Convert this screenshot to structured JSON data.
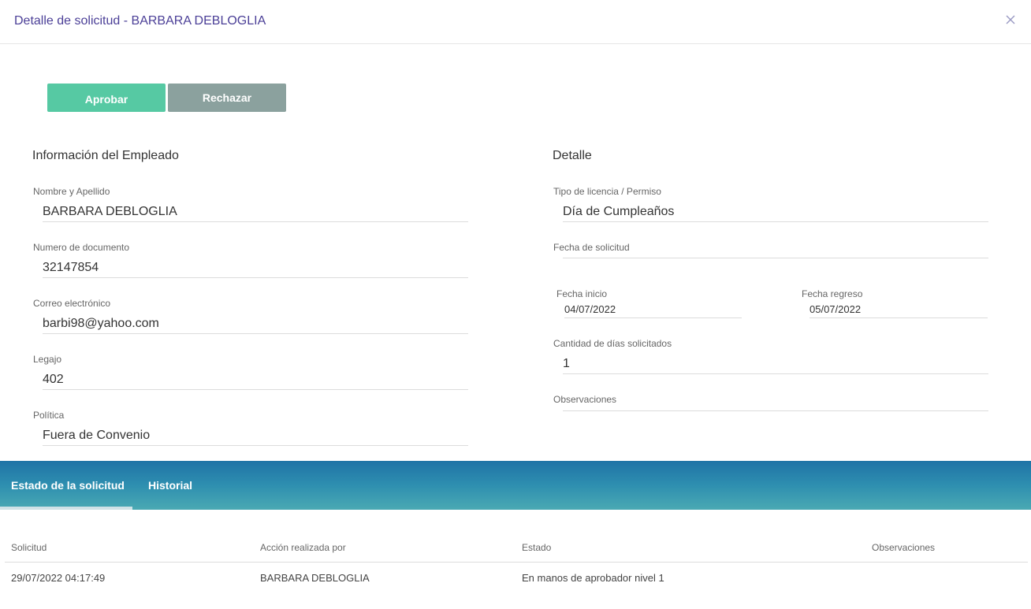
{
  "dialog": {
    "title": "Detalle de solicitud - BARBARA DEBLOGLIA",
    "close_icon": "close-icon"
  },
  "actions": {
    "approve_label": "Aprobar",
    "reject_label": "Rechazar"
  },
  "employee": {
    "section_title": "Información del Empleado",
    "fields": [
      {
        "label": "Nombre y Apellido",
        "value": "BARBARA DEBLOGLIA"
      },
      {
        "label": "Numero de documento",
        "value": "32147854"
      },
      {
        "label": "Correo electrónico",
        "value": "barbi98@yahoo.com"
      },
      {
        "label": "Legajo",
        "value": "402"
      },
      {
        "label": "Política",
        "value": "Fuera de Convenio"
      }
    ]
  },
  "detail": {
    "section_title": "Detalle",
    "license_type": {
      "label": "Tipo de licencia / Permiso",
      "value": "Día de Cumpleaños"
    },
    "request_date": {
      "label": "Fecha de solicitud",
      "value": ""
    },
    "start_date": {
      "label": "Fecha inicio",
      "value": "04/07/2022"
    },
    "return_date": {
      "label": "Fecha regreso",
      "value": "05/07/2022"
    },
    "days_requested": {
      "label": "Cantidad de días solicitados",
      "value": "1"
    },
    "observations": {
      "label": "Observaciones",
      "value": ""
    }
  },
  "tabs": [
    {
      "label": "Estado de la solicitud",
      "active": true
    },
    {
      "label": "Historial",
      "active": false
    }
  ],
  "history_table": {
    "columns": [
      "Solicitud",
      "Acción realizada por",
      "Estado",
      "Observaciones"
    ],
    "rows": [
      [
        "29/07/2022 04:17:49",
        "BARBARA DEBLOGLIA",
        "En manos de aprobador nivel 1",
        ""
      ]
    ]
  },
  "colors": {
    "title": "#4b3f97",
    "approve": "#56c9a3",
    "reject": "#8ba19e",
    "tabs_bar_top": "#1f73a6",
    "tabs_bar_bottom": "#4aa9b3"
  }
}
